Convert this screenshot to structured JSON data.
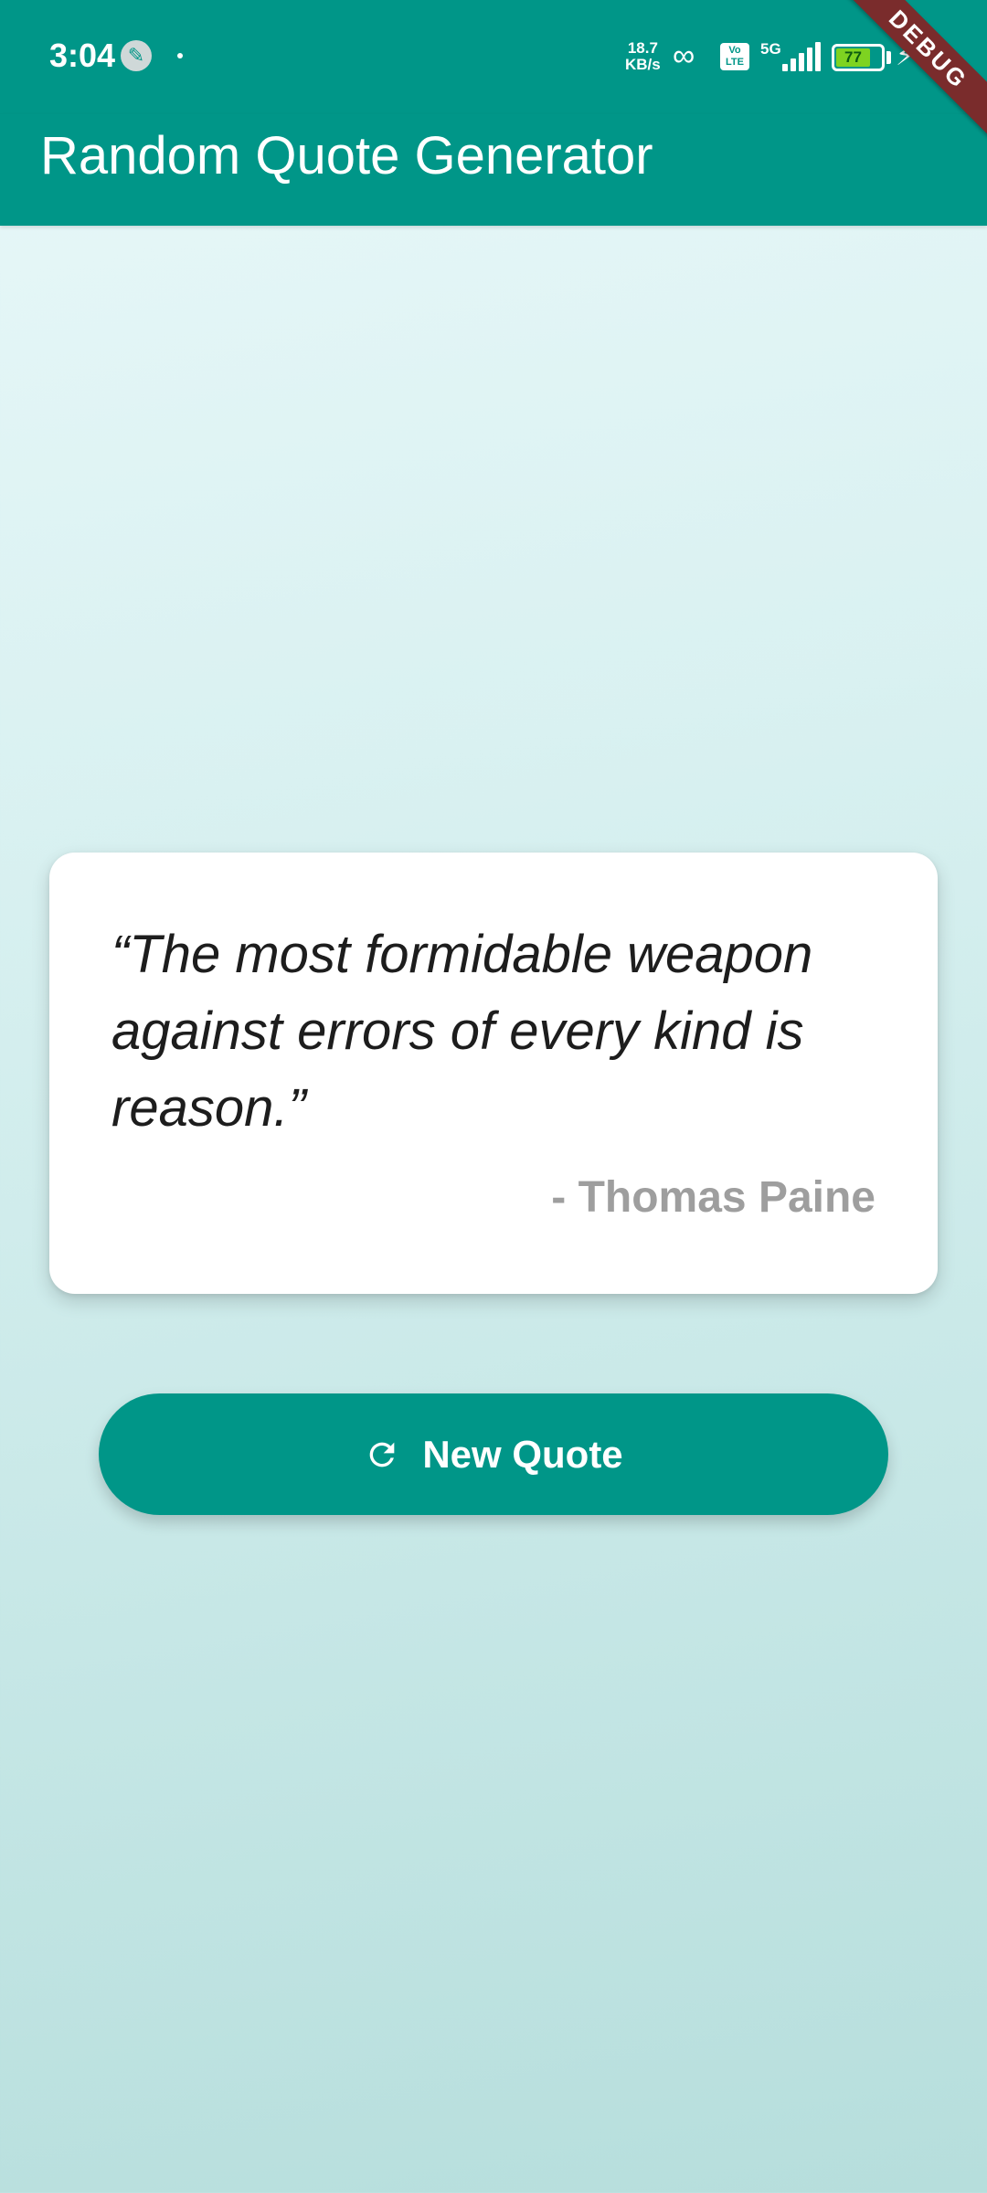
{
  "status_bar": {
    "time": "3:04",
    "speed_value": "18.7",
    "speed_unit": "KB/s",
    "volte_label": "Vo LTE",
    "network_type": "5G",
    "battery_level": "77"
  },
  "app_bar": {
    "title": "Random Quote Generator"
  },
  "debug_banner": "DEBUG",
  "quote": {
    "text": "“The most formidable weapon against errors of every kind is reason.”",
    "author": "- Thomas Paine"
  },
  "new_quote_button": {
    "label": "New Quote",
    "icon": "refresh-icon"
  },
  "colors": {
    "primary": "#009688",
    "author": "#9e9e9e",
    "debug": "#7a2c2c"
  }
}
